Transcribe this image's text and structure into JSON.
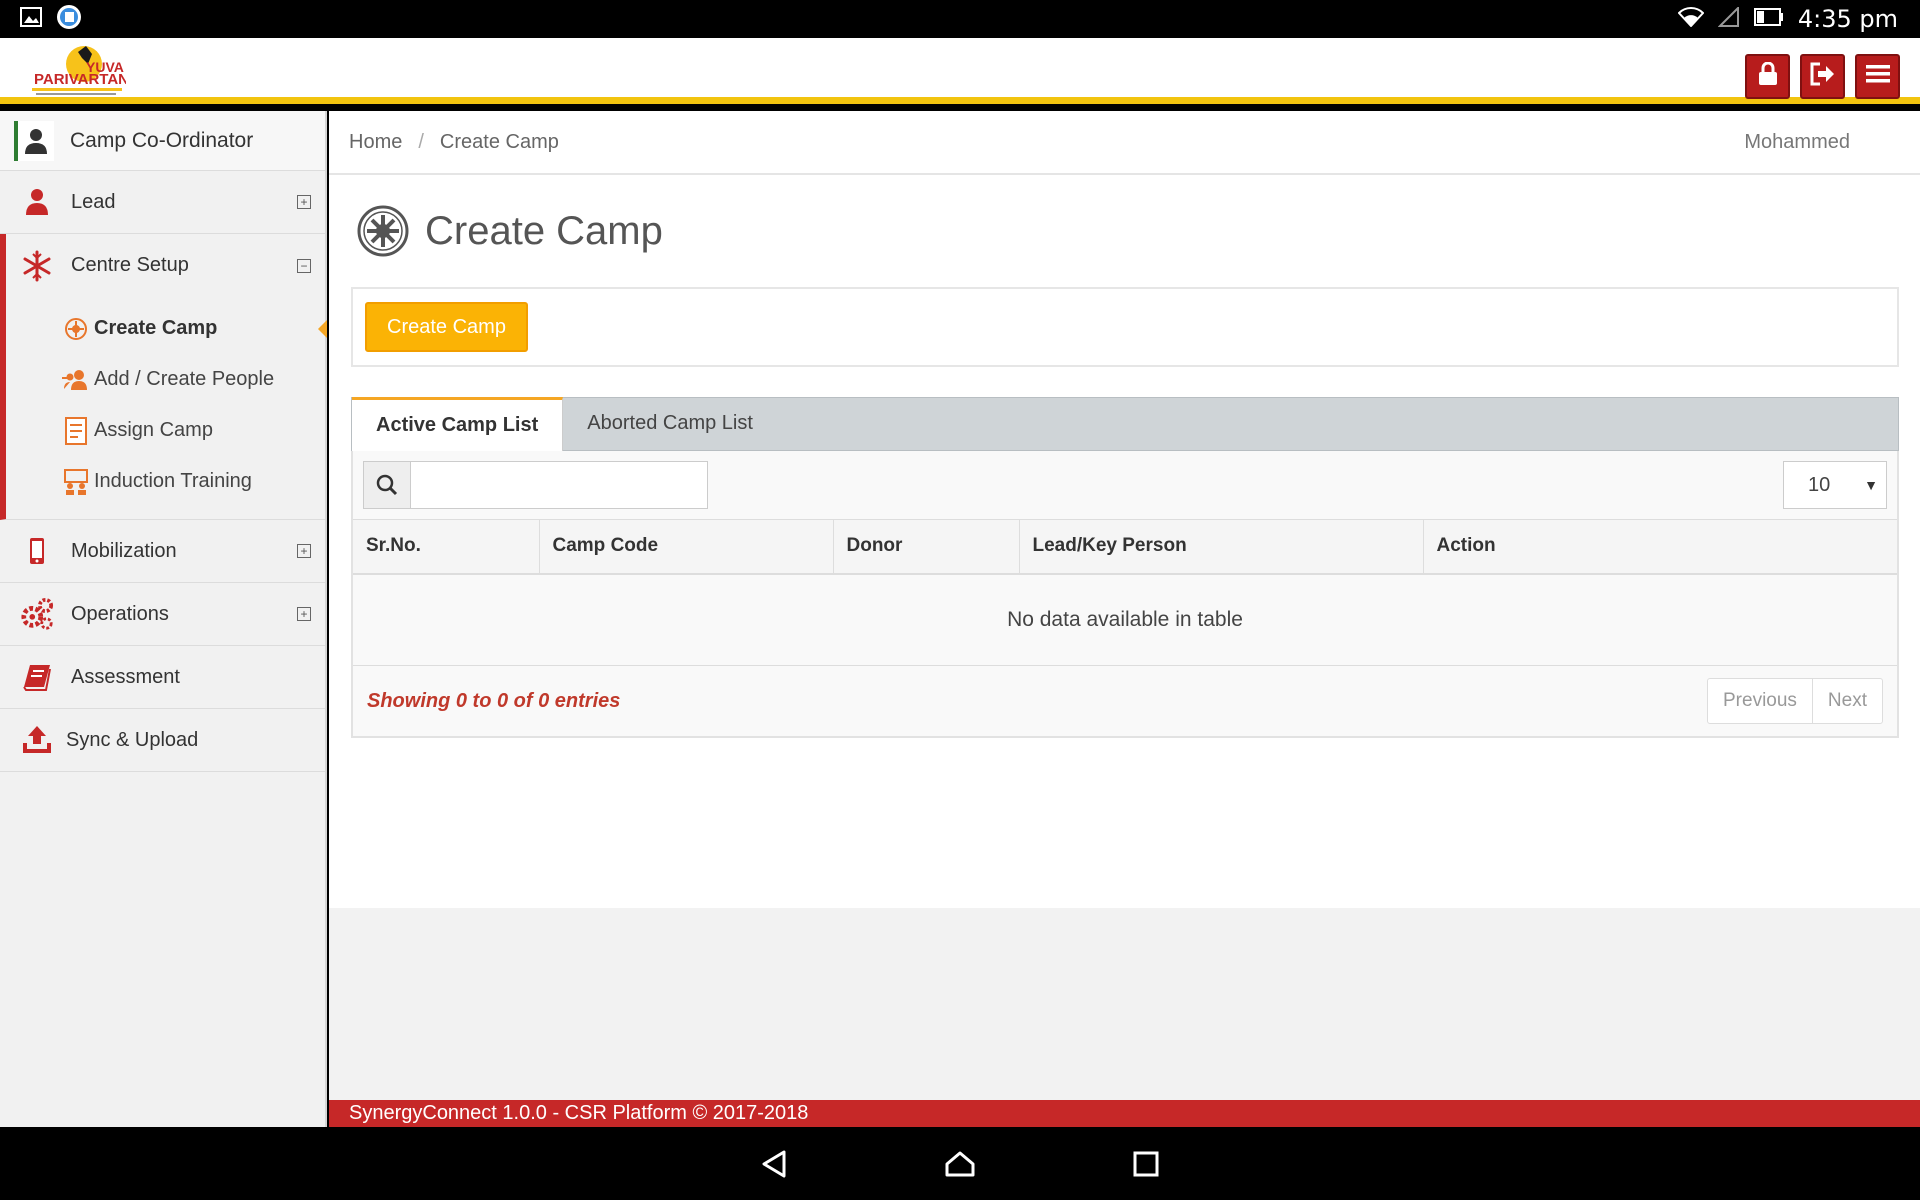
{
  "status_bar": {
    "time": "4:35 pm",
    "left_icons": [
      "image-icon",
      "browser-icon"
    ],
    "right_icons": [
      "wifi-icon",
      "signal-icon",
      "battery-icon"
    ]
  },
  "header": {
    "logo_text_top": "YUVA",
    "logo_text_main": "PARIVARTAN",
    "actions": [
      {
        "name": "lock-icon"
      },
      {
        "name": "logout-icon"
      },
      {
        "name": "menu-icon"
      }
    ]
  },
  "sidebar": {
    "role": "Camp Co-Ordinator",
    "items": [
      {
        "label": "Lead",
        "icon": "person-icon",
        "toggle": "+"
      },
      {
        "label": "Centre Setup",
        "icon": "snowflake-icon",
        "toggle": "−"
      },
      {
        "label": "Mobilization",
        "icon": "mobile-icon",
        "toggle": "+"
      },
      {
        "label": "Operations",
        "icon": "gears-icon",
        "toggle": "+"
      },
      {
        "label": "Assessment",
        "icon": "book-icon"
      },
      {
        "label": "Sync & Upload",
        "icon": "upload-icon"
      }
    ],
    "centre_setup_sub": [
      {
        "label": "Create Camp",
        "icon": "camp-icon",
        "active": true
      },
      {
        "label": "Add / Create People",
        "icon": "people-icon"
      },
      {
        "label": "Assign Camp",
        "icon": "assign-icon"
      },
      {
        "label": "Induction Training",
        "icon": "training-icon"
      }
    ]
  },
  "breadcrumb": {
    "home": "Home",
    "sep": "/",
    "current": "Create Camp",
    "user": "Mohammed"
  },
  "page": {
    "title": "Create Camp",
    "create_button": "Create Camp"
  },
  "tabs": [
    {
      "label": "Active Camp List",
      "active": true
    },
    {
      "label": "Aborted Camp List",
      "active": false
    }
  ],
  "table": {
    "search_placeholder": "",
    "page_size": "10",
    "columns": [
      "Sr.No.",
      "Camp Code",
      "Donor",
      "Lead/Key Person",
      "Action"
    ],
    "empty_message": "No data available in table",
    "info": "Showing 0 to 0 of 0 entries",
    "prev": "Previous",
    "next": "Next"
  },
  "footer": {
    "text": "SynergyConnect 1.0.0 - CSR Platform © 2017-2018"
  },
  "colors": {
    "accent_red": "#c62828",
    "accent_yellow": "#f2c40f",
    "button_orange": "#fbb305"
  }
}
